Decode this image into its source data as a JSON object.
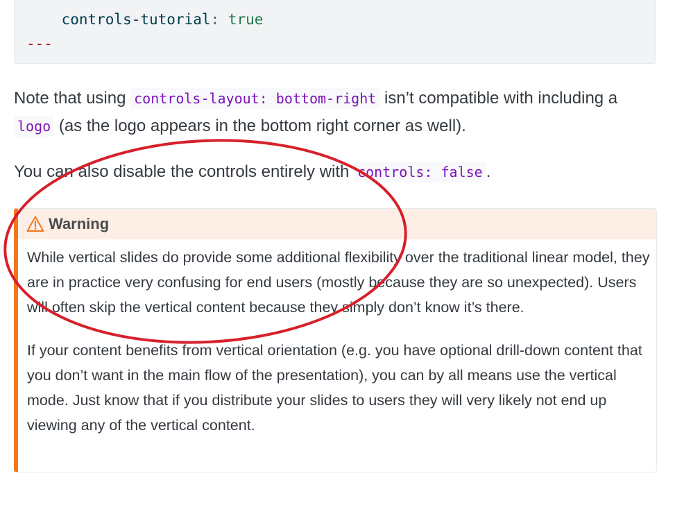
{
  "code_block": {
    "key": "controls-tutorial",
    "colon": ":",
    "value": "true",
    "end_marker": "---"
  },
  "paragraph_1": {
    "text_before": "Note that using ",
    "code_1": "controls-layout: bottom-right",
    "text_middle": " isn’t compatible with including a ",
    "code_2": "logo",
    "text_after": " (as the logo appears in the bottom right corner as well)."
  },
  "paragraph_2": {
    "text_before": "You can also disable the controls entirely with ",
    "code": "controls: false",
    "text_after": "."
  },
  "callout": {
    "icon": "warning-triangle-icon",
    "title": "Warning",
    "accent_color": "#f1771f",
    "header_bg": "#fdefe6",
    "body_1": "While vertical slides do provide some additional flexibility over the traditional linear model, they are in practice very confusing for end users (mostly because they are so unexpected). Users will often skip the vertical content because they simply don’t know it’s there.",
    "body_2": "If your content benefits from vertical orientation (e.g. you have optional drill-down content that you don’t want in the main flow of the presentation), you can by all means use the vertical mode. Just know that if you distribute your slides to users they will very likely not end up viewing any of the vertical content."
  },
  "annotation": {
    "shape": "ellipse",
    "color": "#d7202a"
  }
}
